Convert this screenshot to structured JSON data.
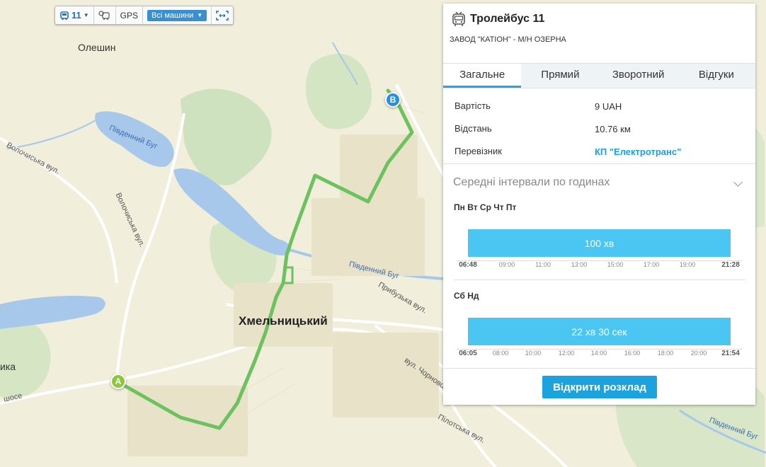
{
  "toolbar": {
    "route_number": "11",
    "gps_label": "GPS",
    "vehicles_select": "Всі машини",
    "route_icon": "trolleybus-icon",
    "vehicle_icon": "vehicle-location-icon",
    "fit_icon": "fit-bounds-icon"
  },
  "map": {
    "labels": {
      "city": "Хмельницький",
      "oleshyn": "Олешин",
      "river1": "Південний Буг",
      "river2": "Південний Буг",
      "river3": "Південний Буг",
      "street_volochyska1": "Волочиська вул.",
      "street_volochyska2": "Волочиська вул.",
      "street_prybuzka": "Прибузька вул.",
      "street_chornovola": "вул. Чорновола",
      "street_pilotska": "Пілотська вул.",
      "shose": "шосе",
      "edge_left": "ика"
    },
    "marker_start": "A",
    "marker_end": "B",
    "route_color": "#6cc25f",
    "water_color": "#a7c8ea"
  },
  "panel": {
    "title": "Тролейбус 11",
    "subtitle": "ЗАВОД \"КАТІОН\" - М/Н ОЗЕРНА",
    "tabs": [
      {
        "label": "Загальне",
        "active": true
      },
      {
        "label": "Прямий",
        "active": false
      },
      {
        "label": "Зворотний",
        "active": false
      },
      {
        "label": "Відгуки",
        "active": false
      }
    ],
    "info": {
      "cost_label": "Вартість",
      "cost_value": "9 UAH",
      "distance_label": "Відстань",
      "distance_value": "10.76 км",
      "carrier_label": "Перевізник",
      "carrier_value": "КП \"Електротранс\""
    },
    "intervals_title": "Середні інтервали по годинах",
    "weekdays": {
      "label": "Пн Вт Ср Чт Пт",
      "interval": "100 хв",
      "start": "06:48",
      "end": "21:28",
      "ticks": [
        "09:00",
        "11:00",
        "13:00",
        "15:00",
        "17:00",
        "19:00"
      ]
    },
    "weekend": {
      "label": "Сб Нд",
      "interval": "22 хв 30 сек",
      "start": "06:05",
      "end": "21:54",
      "ticks": [
        "08:00",
        "10:00",
        "12:00",
        "14:00",
        "16:00",
        "18:00",
        "20:00"
      ]
    },
    "schedule_button": "Відкрити розклад",
    "accent_color": "#4bc6f2"
  }
}
